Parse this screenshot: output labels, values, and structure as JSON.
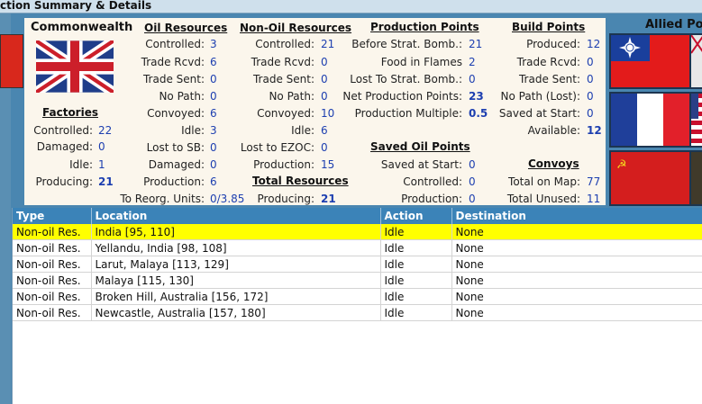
{
  "window": {
    "title": "ction Summary & Details"
  },
  "commonwealth": {
    "title": "Commonwealth",
    "factories": {
      "header": "Factories",
      "rows": [
        {
          "label": "Controlled:",
          "value": "22"
        },
        {
          "label": "Damaged:",
          "value": "0"
        },
        {
          "label": "Idle:",
          "value": "1"
        },
        {
          "label": "Producing:",
          "value": "21"
        }
      ]
    }
  },
  "oil_resources": {
    "header": "Oil Resources",
    "rows": [
      {
        "label": "Controlled:",
        "value": "3"
      },
      {
        "label": "Trade Rcvd:",
        "value": "6"
      },
      {
        "label": "Trade Sent:",
        "value": "0"
      },
      {
        "label": "No Path:",
        "value": "0"
      },
      {
        "label": "Convoyed:",
        "value": "6"
      },
      {
        "label": "Idle:",
        "value": "3"
      },
      {
        "label": "Lost to SB:",
        "value": "0"
      },
      {
        "label": "Damaged:",
        "value": "0"
      },
      {
        "label": "Production:",
        "value": "6"
      }
    ],
    "reorg": {
      "label": "To Reorg. Units:",
      "value": "0/3.85"
    }
  },
  "non_oil_resources": {
    "header": "Non-Oil Resources",
    "rows": [
      {
        "label": "Controlled:",
        "value": "21"
      },
      {
        "label": "Trade Rcvd:",
        "value": "0"
      },
      {
        "label": "Trade Sent:",
        "value": "0"
      },
      {
        "label": "No Path:",
        "value": "0"
      },
      {
        "label": "Convoyed:",
        "value": "10"
      },
      {
        "label": "Idle:",
        "value": "6"
      },
      {
        "label": "Lost to EZOC:",
        "value": "0"
      },
      {
        "label": "Production:",
        "value": "15"
      }
    ],
    "total_header": "Total Resources",
    "total_producing": {
      "label": "Producing:",
      "value": "21"
    }
  },
  "production_points": {
    "header": "Production Points",
    "rows": [
      {
        "label": "Before Strat. Bomb.:",
        "value": "21"
      },
      {
        "label": "Food in Flames",
        "value": "2"
      },
      {
        "label": "Lost To Strat. Bomb.:",
        "value": "0"
      },
      {
        "label": "Net Production Points:",
        "value": "23"
      },
      {
        "label": "Production Multiple:",
        "value": "0.5"
      }
    ]
  },
  "saved_oil_points": {
    "header": "Saved Oil Points",
    "rows": [
      {
        "label": "Saved at Start:",
        "value": "0"
      },
      {
        "label": "Controlled:",
        "value": "0"
      },
      {
        "label": "Production:",
        "value": "0"
      }
    ]
  },
  "build_points": {
    "header": "Build Points",
    "rows": [
      {
        "label": "Produced:",
        "value": "12"
      },
      {
        "label": "Trade Rcvd:",
        "value": "0"
      },
      {
        "label": "Trade Sent:",
        "value": "0"
      },
      {
        "label": "No Path (Lost):",
        "value": "0"
      },
      {
        "label": "Saved at Start:",
        "value": "0"
      },
      {
        "label": "Available:",
        "value": "12"
      }
    ]
  },
  "convoys": {
    "header": "Convoys",
    "rows": [
      {
        "label": "Total on Map:",
        "value": "77"
      },
      {
        "label": "Total Unused:",
        "value": "11"
      }
    ]
  },
  "allied": {
    "label": "Allied Po",
    "flags": [
      "china-flag",
      "france-flag",
      "ussr-flag"
    ]
  },
  "table": {
    "columns": [
      "Type",
      "Location",
      "Action",
      "Destination"
    ],
    "rows": [
      {
        "type": "Non-oil Res.",
        "location": "India [95, 110]",
        "action": "Idle",
        "destination": "None",
        "selected": true
      },
      {
        "type": "Non-oil Res.",
        "location": "Yellandu, India [98, 108]",
        "action": "Idle",
        "destination": "None"
      },
      {
        "type": "Non-oil Res.",
        "location": "Larut, Malaya [113, 129]",
        "action": "Idle",
        "destination": "None"
      },
      {
        "type": "Non-oil Res.",
        "location": "Malaya [115, 130]",
        "action": "Idle",
        "destination": "None"
      },
      {
        "type": "Non-oil Res.",
        "location": "Broken Hill, Australia [156, 172]",
        "action": "Idle",
        "destination": "None"
      },
      {
        "type": "Non-oil Res.",
        "location": "Newcastle, Australia [157, 180]",
        "action": "Idle",
        "destination": "None"
      }
    ]
  },
  "colors": {
    "value_blue": "#1d3fb0",
    "selected_row": "#ffff00",
    "header_bg": "#3b83b8",
    "panel_bg": "#fbf6ec"
  }
}
